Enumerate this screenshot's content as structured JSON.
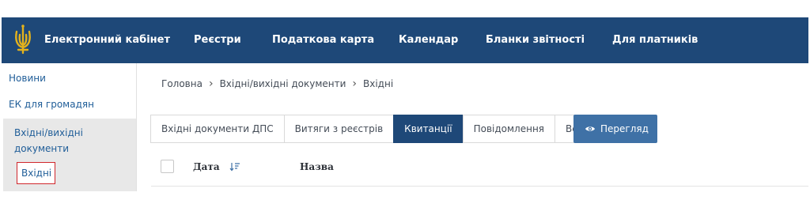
{
  "header": {
    "brand": "Електронний кабінет",
    "nav": [
      {
        "label": "Реєстри"
      },
      {
        "label": "Податкова карта"
      },
      {
        "label": "Календар"
      },
      {
        "label": "Бланки звітності"
      },
      {
        "label": "Для платників"
      }
    ],
    "icon": "trident-logo-icon"
  },
  "sidebar": {
    "items": [
      {
        "label": "Новини"
      },
      {
        "label": "ЕК для громадян"
      }
    ],
    "group": {
      "label": "Вхідні/вихідні документи",
      "sub_item": "Вхідні"
    }
  },
  "breadcrumb": {
    "items": [
      "Головна",
      "Вхідні/вихідні документи",
      "Вхідні"
    ]
  },
  "tabs": [
    {
      "label": "Вхідні документи ДПС",
      "active": false
    },
    {
      "label": "Витяги з реєстрів",
      "active": false
    },
    {
      "label": "Квитанції",
      "active": true
    },
    {
      "label": "Повідомлення",
      "active": false
    },
    {
      "label": "Всі",
      "active": false
    }
  ],
  "view_button": {
    "label": "Перегляд",
    "icon": "eye-icon"
  },
  "table": {
    "columns": [
      "Дата",
      "Назва"
    ],
    "sort_icon": "sort-descending-icon"
  },
  "colors": {
    "header_bg": "#1e4878",
    "active_tab_bg": "#1e4878",
    "view_button_bg": "#3f71a6",
    "logo_gold": "#e3b21c",
    "highlight_border": "#d0262c",
    "link": "#1f5d98"
  }
}
